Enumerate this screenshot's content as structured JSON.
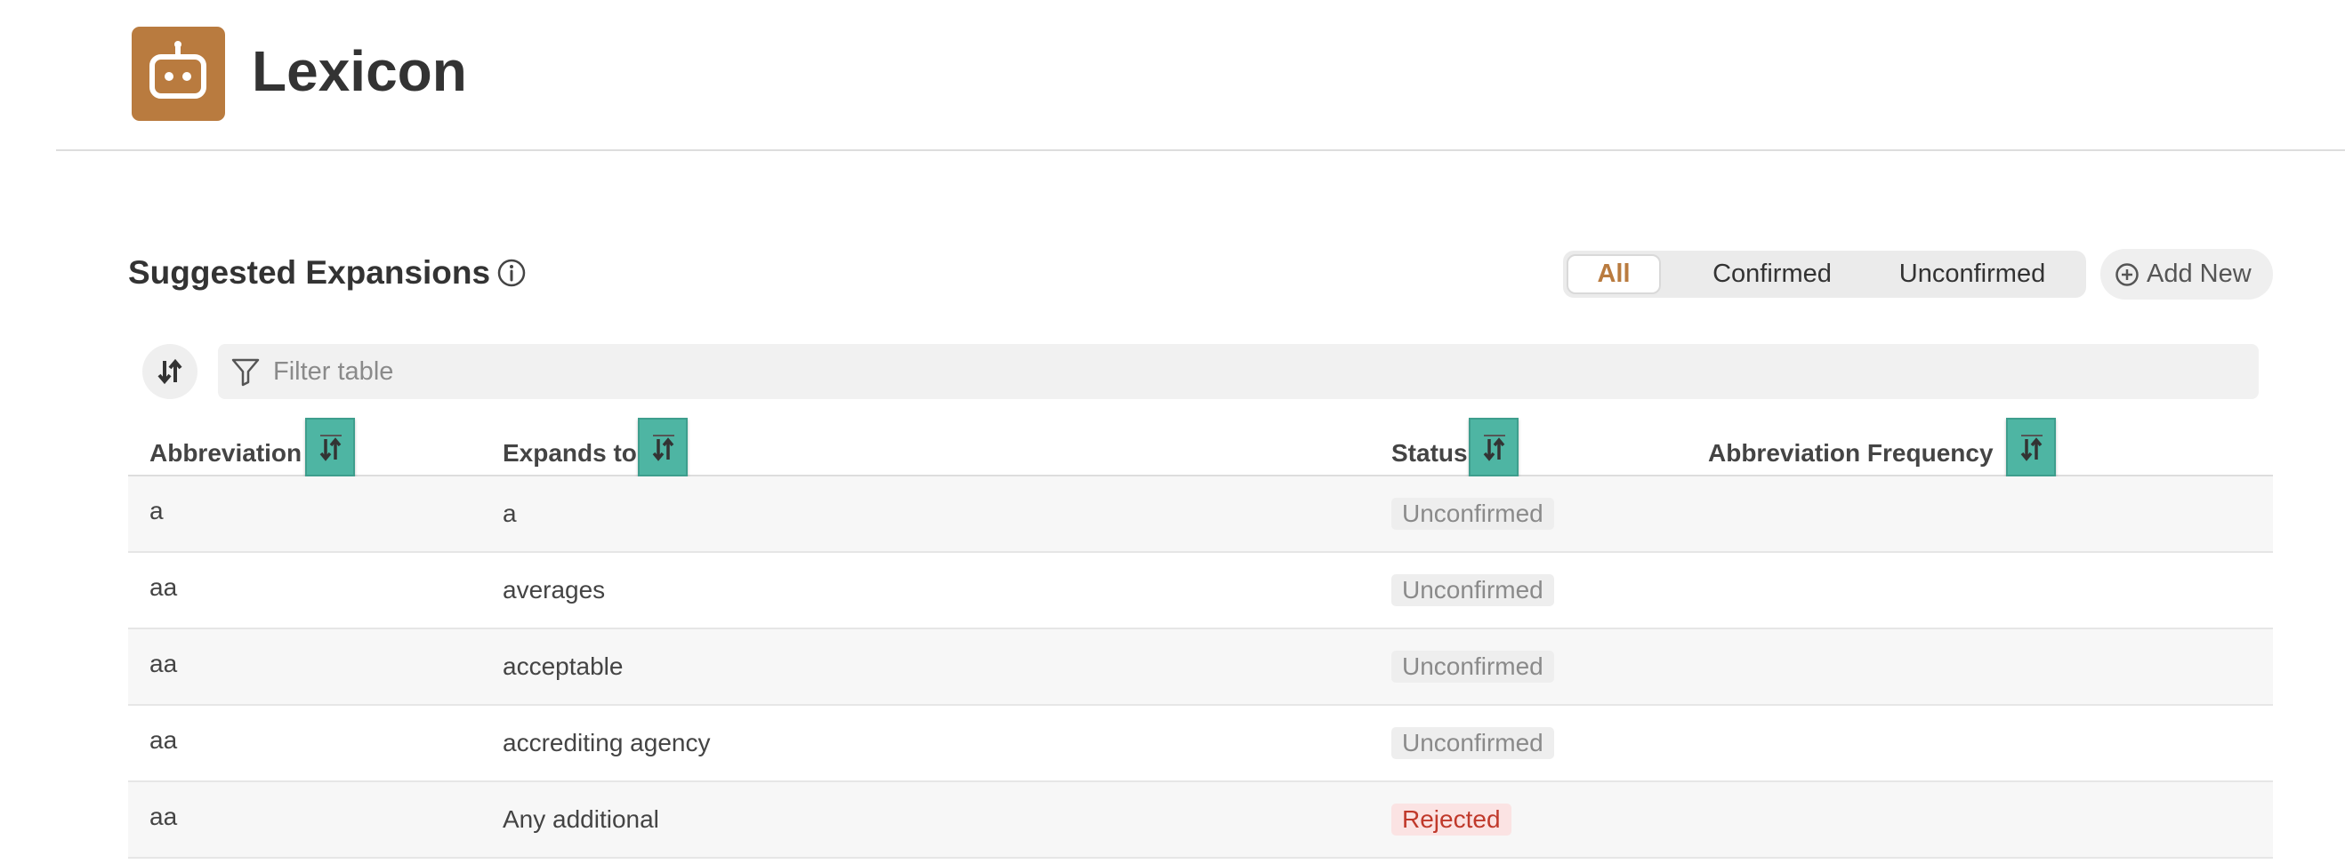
{
  "app": {
    "title": "Lexicon",
    "logo_icon": "robot-icon",
    "brand_color": "#b97b3f"
  },
  "section": {
    "title": "Suggested Expansions",
    "info_icon": "info-icon"
  },
  "filters": {
    "segments": [
      "All",
      "Confirmed",
      "Unconfirmed"
    ],
    "selected": "All",
    "add_new_label": "Add New"
  },
  "search": {
    "placeholder": "Filter table",
    "value": ""
  },
  "table": {
    "columns": [
      "Abbreviation",
      "Expands to",
      "Status",
      "Abbreviation Frequency"
    ],
    "sort_highlight_color": "#4eb5a3",
    "rows": [
      {
        "abbreviation": "a",
        "expands_to": "a",
        "status": "Unconfirmed",
        "frequency": ""
      },
      {
        "abbreviation": "aa",
        "expands_to": "averages",
        "status": "Unconfirmed",
        "frequency": ""
      },
      {
        "abbreviation": "aa",
        "expands_to": "acceptable",
        "status": "Unconfirmed",
        "frequency": ""
      },
      {
        "abbreviation": "aa",
        "expands_to": "accrediting agency",
        "status": "Unconfirmed",
        "frequency": ""
      },
      {
        "abbreviation": "aa",
        "expands_to": "Any additional",
        "status": "Rejected",
        "frequency": ""
      }
    ]
  },
  "status_colors": {
    "Unconfirmed": "#8a8a8a",
    "Rejected": "#c0392b"
  }
}
